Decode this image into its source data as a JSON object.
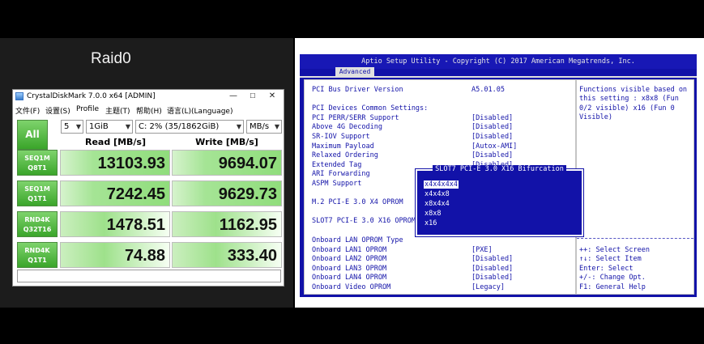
{
  "left": {
    "title": "Raid0"
  },
  "cdm": {
    "window_title": "CrystalDiskMark 7.0.0 x64 [ADMIN]",
    "window_controls": {
      "min": "—",
      "max": "☐",
      "close": "✕"
    },
    "menu": [
      "文件(F)",
      "设置(S)",
      "Profile",
      "主题(T)",
      "帮助(H)",
      "语言(L)(Language)"
    ],
    "all_button": "All",
    "count": "5",
    "size": "1GiB",
    "drive": "C: 2% (35/1862GiB)",
    "unit": "MB/s",
    "read_header": "Read [MB/s]",
    "write_header": "Write [MB/s]",
    "rows": [
      {
        "line1": "SEQ1M",
        "line2": "Q8T1",
        "read": "13103.93",
        "write": "9694.07"
      },
      {
        "line1": "SEQ1M",
        "line2": "Q1T1",
        "read": "7242.45",
        "write": "9629.73"
      },
      {
        "line1": "RND4K",
        "line2": "Q32T16",
        "read": "1478.51",
        "write": "1162.95"
      },
      {
        "line1": "RND4K",
        "line2": "Q1T1",
        "read": "74.88",
        "write": "333.40"
      }
    ],
    "colors": {
      "bar": "#90dd7c",
      "button": "#3aa52a"
    }
  },
  "bios": {
    "header": "Aptio Setup Utility - Copyright (C) 2017 American Megatrends, Inc.",
    "tab": "Advanced",
    "lines": [
      {
        "label": "PCI Bus Driver Version",
        "value": "A5.01.05"
      },
      {
        "label": "PCI Devices Common Settings:",
        "value": ""
      },
      {
        "label": "PCI PERR/SERR Support",
        "value": "[Disabled]"
      },
      {
        "label": "Above 4G Decoding",
        "value": "[Disabled]"
      },
      {
        "label": "SR-IOV Support",
        "value": "[Disabled]"
      },
      {
        "label": "Maximum Payload",
        "value": "[Autox-AMI]"
      },
      {
        "label": "Relaxed Ordering",
        "value": "[Disabled]"
      },
      {
        "label": "Extended Tag",
        "value": "[Disabled]"
      },
      {
        "label": "ARI Forwarding",
        "value": ""
      },
      {
        "label": "ASPM Support",
        "value": ""
      },
      {
        "label": "M.2 PCI-E 3.0 X4 OPROM",
        "value": ""
      },
      {
        "label": "SLOT7 PCI-E 3.0 X16 OPROM",
        "value": ""
      },
      {
        "label": "Onboard LAN OPROM Type",
        "value": ""
      },
      {
        "label": "Onboard LAN1 OPROM",
        "value": "[PXE]"
      },
      {
        "label": "Onboard LAN2 OPROM",
        "value": "[Disabled]"
      },
      {
        "label": "Onboard LAN3 OPROM",
        "value": "[Disabled]"
      },
      {
        "label": "Onboard LAN4 OPROM",
        "value": "[Disabled]"
      },
      {
        "label": "Onboard Video OPROM",
        "value": "[Legacy]"
      }
    ],
    "help_lines": [
      "Functions visible based on",
      "this setting : x8x8 (Fun",
      "0/2 visible) x16 (Fun 0",
      "Visible)"
    ],
    "key_lines": [
      "++: Select Screen",
      "↑↓: Select Item",
      "Enter: Select",
      "+/-: Change Opt.",
      "F1: General Help"
    ],
    "popup": {
      "title": "SLOT7 PCI-E 3.0 X16 Bifurcation",
      "options": [
        "x4x4x4x4",
        "x4x4x8",
        "x8x4x4",
        "x8x8",
        "x16"
      ],
      "selected": "x4x4x4x4"
    },
    "colors": {
      "background": "#1212a8",
      "text_panel": "#ffffff"
    }
  }
}
